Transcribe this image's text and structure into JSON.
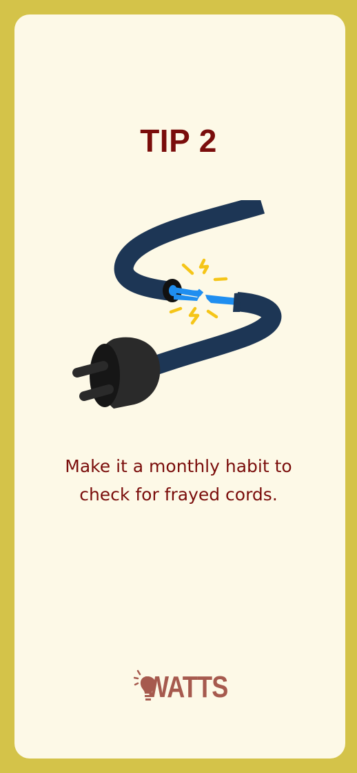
{
  "tip": {
    "title": "TIP 2",
    "text_line1": "Make it a monthly habit to",
    "text_line2": "check for frayed cords."
  },
  "brand": {
    "logo_text": "WATTS"
  },
  "colors": {
    "border": "#d4c349",
    "card": "#fdf9e7",
    "title": "#7a0d0b",
    "cord": "#1d3655",
    "wire": "#1f8ef0",
    "plug": "#2a2a2a",
    "spark": "#f5c518",
    "logo": "#a65a4e"
  },
  "illustration": {
    "icon": "frayed-cord-plug-illustration"
  }
}
